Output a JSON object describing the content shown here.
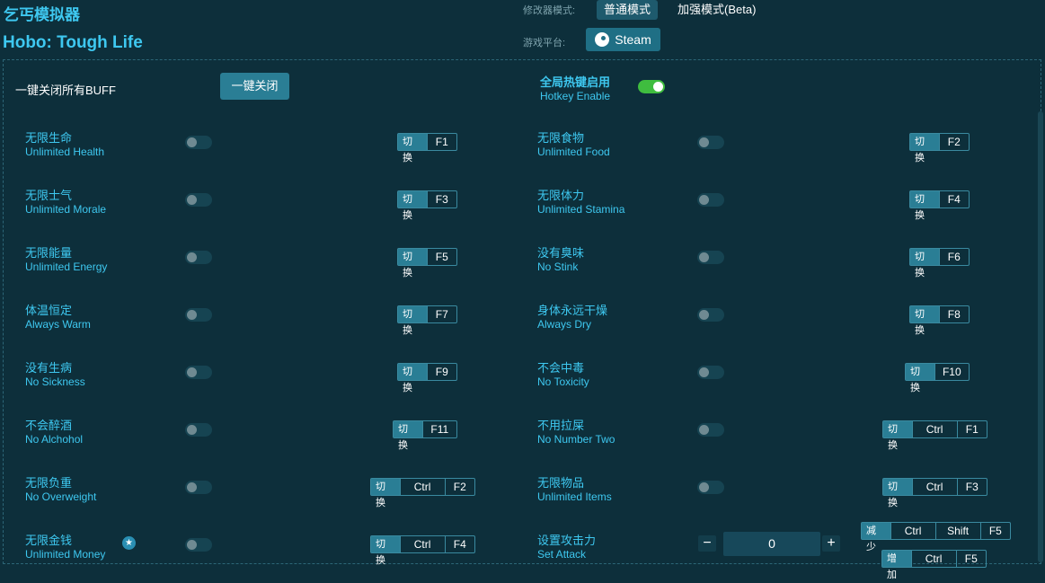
{
  "header": {
    "title_cn": "乞丐模拟器",
    "title_en": "Hobo: Tough Life",
    "mode_label": "修改器模式:",
    "mode_normal": "普通模式",
    "mode_enhanced": "加强模式(Beta)",
    "platform_label": "游戏平台:",
    "platform": "Steam"
  },
  "controls": {
    "close_all_label": "一键关闭所有BUFF",
    "close_all_button": "一键关闭",
    "hotkey_cn": "全局热键启用",
    "hotkey_en": "Hotkey Enable",
    "hotkey_enabled": true
  },
  "cheats": [
    {
      "cn": "无限生命",
      "en": "Unlimited Health",
      "switch": "切换",
      "keys": [
        "F1"
      ]
    },
    {
      "cn": "无限食物",
      "en": "Unlimited Food",
      "switch": "切换",
      "keys": [
        "F2"
      ]
    },
    {
      "cn": "无限士气",
      "en": "Unlimited Morale",
      "switch": "切换",
      "keys": [
        "F3"
      ]
    },
    {
      "cn": "无限体力",
      "en": "Unlimited Stamina",
      "switch": "切换",
      "keys": [
        "F4"
      ]
    },
    {
      "cn": "无限能量",
      "en": "Unlimited Energy",
      "switch": "切换",
      "keys": [
        "F5"
      ]
    },
    {
      "cn": "没有臭味",
      "en": "No Stink",
      "switch": "切换",
      "keys": [
        "F6"
      ]
    },
    {
      "cn": "体温恒定",
      "en": "Always Warm",
      "switch": "切换",
      "keys": [
        "F7"
      ]
    },
    {
      "cn": "身体永远干燥",
      "en": "Always Dry",
      "switch": "切换",
      "keys": [
        "F8"
      ]
    },
    {
      "cn": "没有生病",
      "en": "No Sickness",
      "switch": "切换",
      "keys": [
        "F9"
      ]
    },
    {
      "cn": "不会中毒",
      "en": "No Toxicity",
      "switch": "切换",
      "keys": [
        "F10"
      ]
    },
    {
      "cn": "不会醉酒",
      "en": "No Alchohol",
      "switch": "切换",
      "keys": [
        "F11"
      ]
    },
    {
      "cn": "不用拉屎",
      "en": "No Number Two",
      "switch": "切换",
      "keys": [
        "Ctrl",
        "F1"
      ]
    },
    {
      "cn": "无限负重",
      "en": "No Overweight",
      "switch": "切换",
      "keys": [
        "Ctrl",
        "F2"
      ]
    },
    {
      "cn": "无限物品",
      "en": "Unlimited Items",
      "switch": "切换",
      "keys": [
        "Ctrl",
        "F3"
      ]
    },
    {
      "cn": "无限金钱",
      "en": "Unlimited Money",
      "switch": "切换",
      "keys": [
        "Ctrl",
        "F4"
      ]
    }
  ],
  "attack": {
    "cn": "设置攻击力",
    "en": "Set Attack",
    "value": "0",
    "minus": "−",
    "plus": "+",
    "decrease_label": "减少",
    "decrease_keys": [
      "Ctrl",
      "Shift",
      "F5"
    ],
    "increase_label": "增加",
    "increase_keys": [
      "Ctrl",
      "F5"
    ]
  }
}
